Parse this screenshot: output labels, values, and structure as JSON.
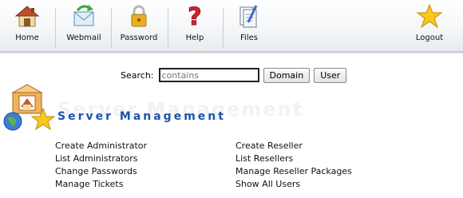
{
  "toolbar": {
    "home": "Home",
    "webmail": "Webmail",
    "password": "Password",
    "help": "Help",
    "files": "Files",
    "logout": "Logout"
  },
  "search": {
    "label": "Search:",
    "placeholder": "contains",
    "domain_button": "Domain",
    "user_button": "User"
  },
  "section": {
    "title": "Server Management"
  },
  "links_left": [
    "Create Administrator",
    "List Administrators",
    "Change Passwords",
    "Manage Tickets"
  ],
  "links_right": [
    "Create Reseller",
    "List Resellers",
    "Manage Reseller Packages",
    "Show All Users"
  ],
  "colors": {
    "title_blue": "#1b53ae",
    "star_yellow": "#f7c81d",
    "help_red": "#d8212b",
    "lock_gold": "#e8b021"
  },
  "icons": [
    "home-icon",
    "webmail-icon",
    "lock-icon",
    "help-icon",
    "files-icon",
    "star-icon"
  ]
}
